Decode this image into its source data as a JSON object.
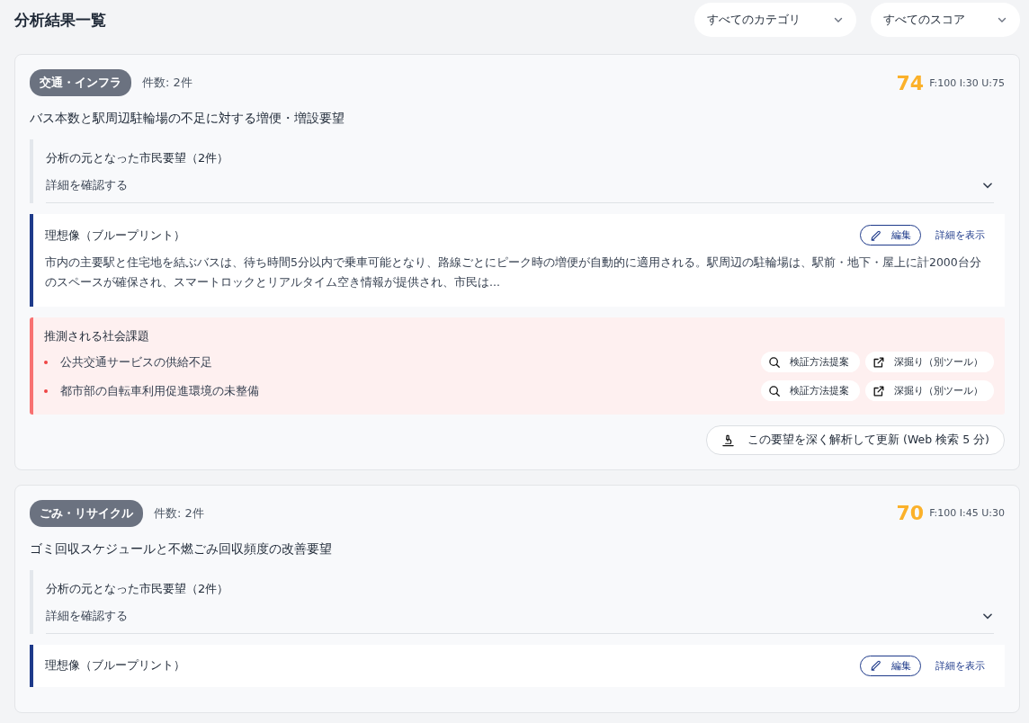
{
  "page_title": "分析結果一覧",
  "filters": [
    {
      "label": "すべてのカテゴリ"
    },
    {
      "label": "すべてのスコア"
    }
  ],
  "cards": [
    {
      "category": "交通・インフラ",
      "count": "件数: 2件",
      "score": "74",
      "score_detail": "F:100 I:30 U:75",
      "title": "バス本数と駅周辺駐輪場の不足に対する増便・増設要望",
      "source": {
        "heading": "分析の元となった市民要望（2件）",
        "toggle": "詳細を確認する",
        "expanded": false
      },
      "blueprint": {
        "heading": "理想像（ブループリント）",
        "edit": "編集",
        "detail": "詳細を表示",
        "body": "市内の主要駅と住宅地を結ぶバスは、待ち時間5分以内で乗車可能となり、路線ごとにピーク時の増便が自動的に適用される。駅周辺の駐輪場は、駅前・地下・屋上に計2000台分のスペースが確保され、スマートロックとリアルタイム空き情報が提供され、市民は..."
      },
      "issues": {
        "heading": "推測される社会課題",
        "items": [
          {
            "text": "公共交通サービスの供給不足",
            "verify": "検証方法提案",
            "deep": "深掘り（別ツール）"
          },
          {
            "text": "都市部の自転車利用促進環境の未整備",
            "verify": "検証方法提案",
            "deep": "深掘り（別ツール）"
          }
        ]
      },
      "analyze": "この要望を深く解析して更新 (Web 検索 5 分)"
    },
    {
      "category": "ごみ・リサイクル",
      "count": "件数: 2件",
      "score": "70",
      "score_detail": "F:100 I:45 U:30",
      "title": "ゴミ回収スケジュールと不燃ごみ回収頻度の改善要望",
      "source": {
        "heading": "分析の元となった市民要望（2件）",
        "toggle": "詳細を確認する",
        "expanded": false
      },
      "blueprint": {
        "heading": "理想像（ブループリント）",
        "edit": "編集",
        "detail": "詳細を表示"
      }
    }
  ]
}
